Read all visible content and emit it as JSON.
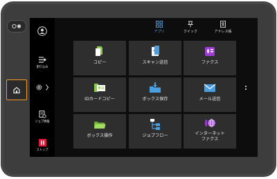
{
  "sidebar": {
    "user_button": "",
    "interrupt_label": "割り込み",
    "job_status_label": "ジョブ情報",
    "stop_label": "ストップ"
  },
  "tabs": [
    {
      "label": "アプリ",
      "active": true
    },
    {
      "label": "クイック",
      "active": false
    },
    {
      "label": "アドレス帳",
      "active": false
    }
  ],
  "apps": [
    {
      "label": "コピー",
      "icon": "copy-icon"
    },
    {
      "label": "スキャン送信",
      "icon": "scan-send-icon"
    },
    {
      "label": "ファクス",
      "icon": "fax-icon"
    },
    {
      "label": "IDカードコピー",
      "icon": "id-card-copy-icon"
    },
    {
      "label": "ボックス保存",
      "icon": "box-save-icon"
    },
    {
      "label": "メール送信",
      "icon": "mail-send-icon"
    },
    {
      "label": "ボックス操作",
      "icon": "box-operation-icon"
    },
    {
      "label": "ジョブフロー",
      "icon": "job-flow-icon"
    },
    {
      "label": "インターネット",
      "label2": "ファクス",
      "icon": "internet-fax-icon"
    }
  ],
  "colors": {
    "accent_blue": "#5fa8e8",
    "home_highlight": "#f19a25",
    "stop_red": "#d81a3c",
    "tile_bg": "#2e2e2e"
  }
}
